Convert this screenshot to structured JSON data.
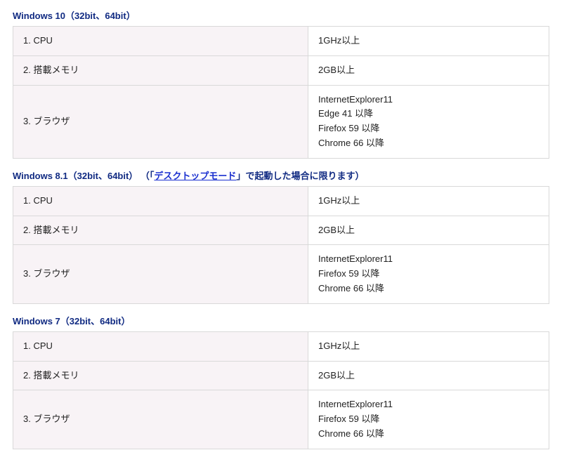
{
  "sections": [
    {
      "title_prefix": "Windows 10（32bit、64bit）",
      "title_link": "",
      "title_suffix": "",
      "rows": [
        {
          "label": "1. CPU",
          "value": "1GHz以上"
        },
        {
          "label": "2. 搭載メモリ",
          "value": "2GB以上"
        },
        {
          "label": "3. ブラウザ",
          "value": "InternetExplorer11\nEdge 41 以降\nFirefox 59 以降\nChrome 66 以降"
        }
      ]
    },
    {
      "title_prefix": "Windows 8.1（32bit、64bit） （「",
      "title_link": "デスクトップモード",
      "title_suffix": "」で起動した場合に限ります）",
      "rows": [
        {
          "label": "1. CPU",
          "value": "1GHz以上"
        },
        {
          "label": "2. 搭載メモリ",
          "value": "2GB以上"
        },
        {
          "label": "3. ブラウザ",
          "value": "InternetExplorer11\nFirefox 59 以降\nChrome 66 以降"
        }
      ]
    },
    {
      "title_prefix": "Windows 7（32bit、64bit）",
      "title_link": "",
      "title_suffix": "",
      "rows": [
        {
          "label": "1. CPU",
          "value": "1GHz以上"
        },
        {
          "label": "2. 搭載メモリ",
          "value": "2GB以上"
        },
        {
          "label": "3. ブラウザ",
          "value": "InternetExplorer11\nFirefox 59 以降\nChrome 66 以降"
        }
      ]
    }
  ]
}
